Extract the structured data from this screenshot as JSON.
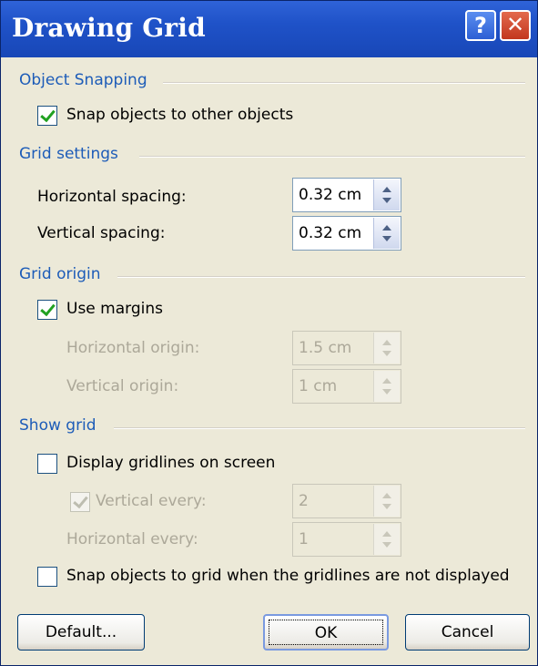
{
  "window": {
    "title": "Drawing Grid",
    "help_label": "?",
    "close_label": "✕"
  },
  "object_snapping": {
    "header": "Object Snapping",
    "snap_to_objects": {
      "label": "Snap objects to other objects",
      "checked": true
    }
  },
  "grid_settings": {
    "header": "Grid settings",
    "horizontal_spacing": {
      "label": "Horizontal spacing:",
      "value": "0.32 cm"
    },
    "vertical_spacing": {
      "label": "Vertical spacing:",
      "value": "0.32 cm"
    }
  },
  "grid_origin": {
    "header": "Grid origin",
    "use_margins": {
      "label": "Use margins",
      "checked": true
    },
    "horizontal_origin": {
      "label": "Horizontal origin:",
      "value": "1.5 cm",
      "disabled": true
    },
    "vertical_origin": {
      "label": "Vertical origin:",
      "value": "1 cm",
      "disabled": true
    }
  },
  "show_grid": {
    "header": "Show grid",
    "display_gridlines": {
      "label": "Display gridlines on screen",
      "checked": false
    },
    "vertical_every": {
      "label": "Vertical every:",
      "value": "2",
      "checked": true,
      "disabled": true
    },
    "horizontal_every": {
      "label": "Horizontal every:",
      "value": "1",
      "disabled": true
    },
    "snap_to_grid": {
      "label": "Snap objects to grid when the gridlines are not displayed",
      "checked": false
    }
  },
  "buttons": {
    "default_label": "Default...",
    "ok_label": "OK",
    "cancel_label": "Cancel"
  },
  "colors": {
    "titlebar": "#1f52c8",
    "section_header": "#1d5cb8",
    "dialog_bg": "#ece9d8",
    "check_mark": "#21a121"
  }
}
